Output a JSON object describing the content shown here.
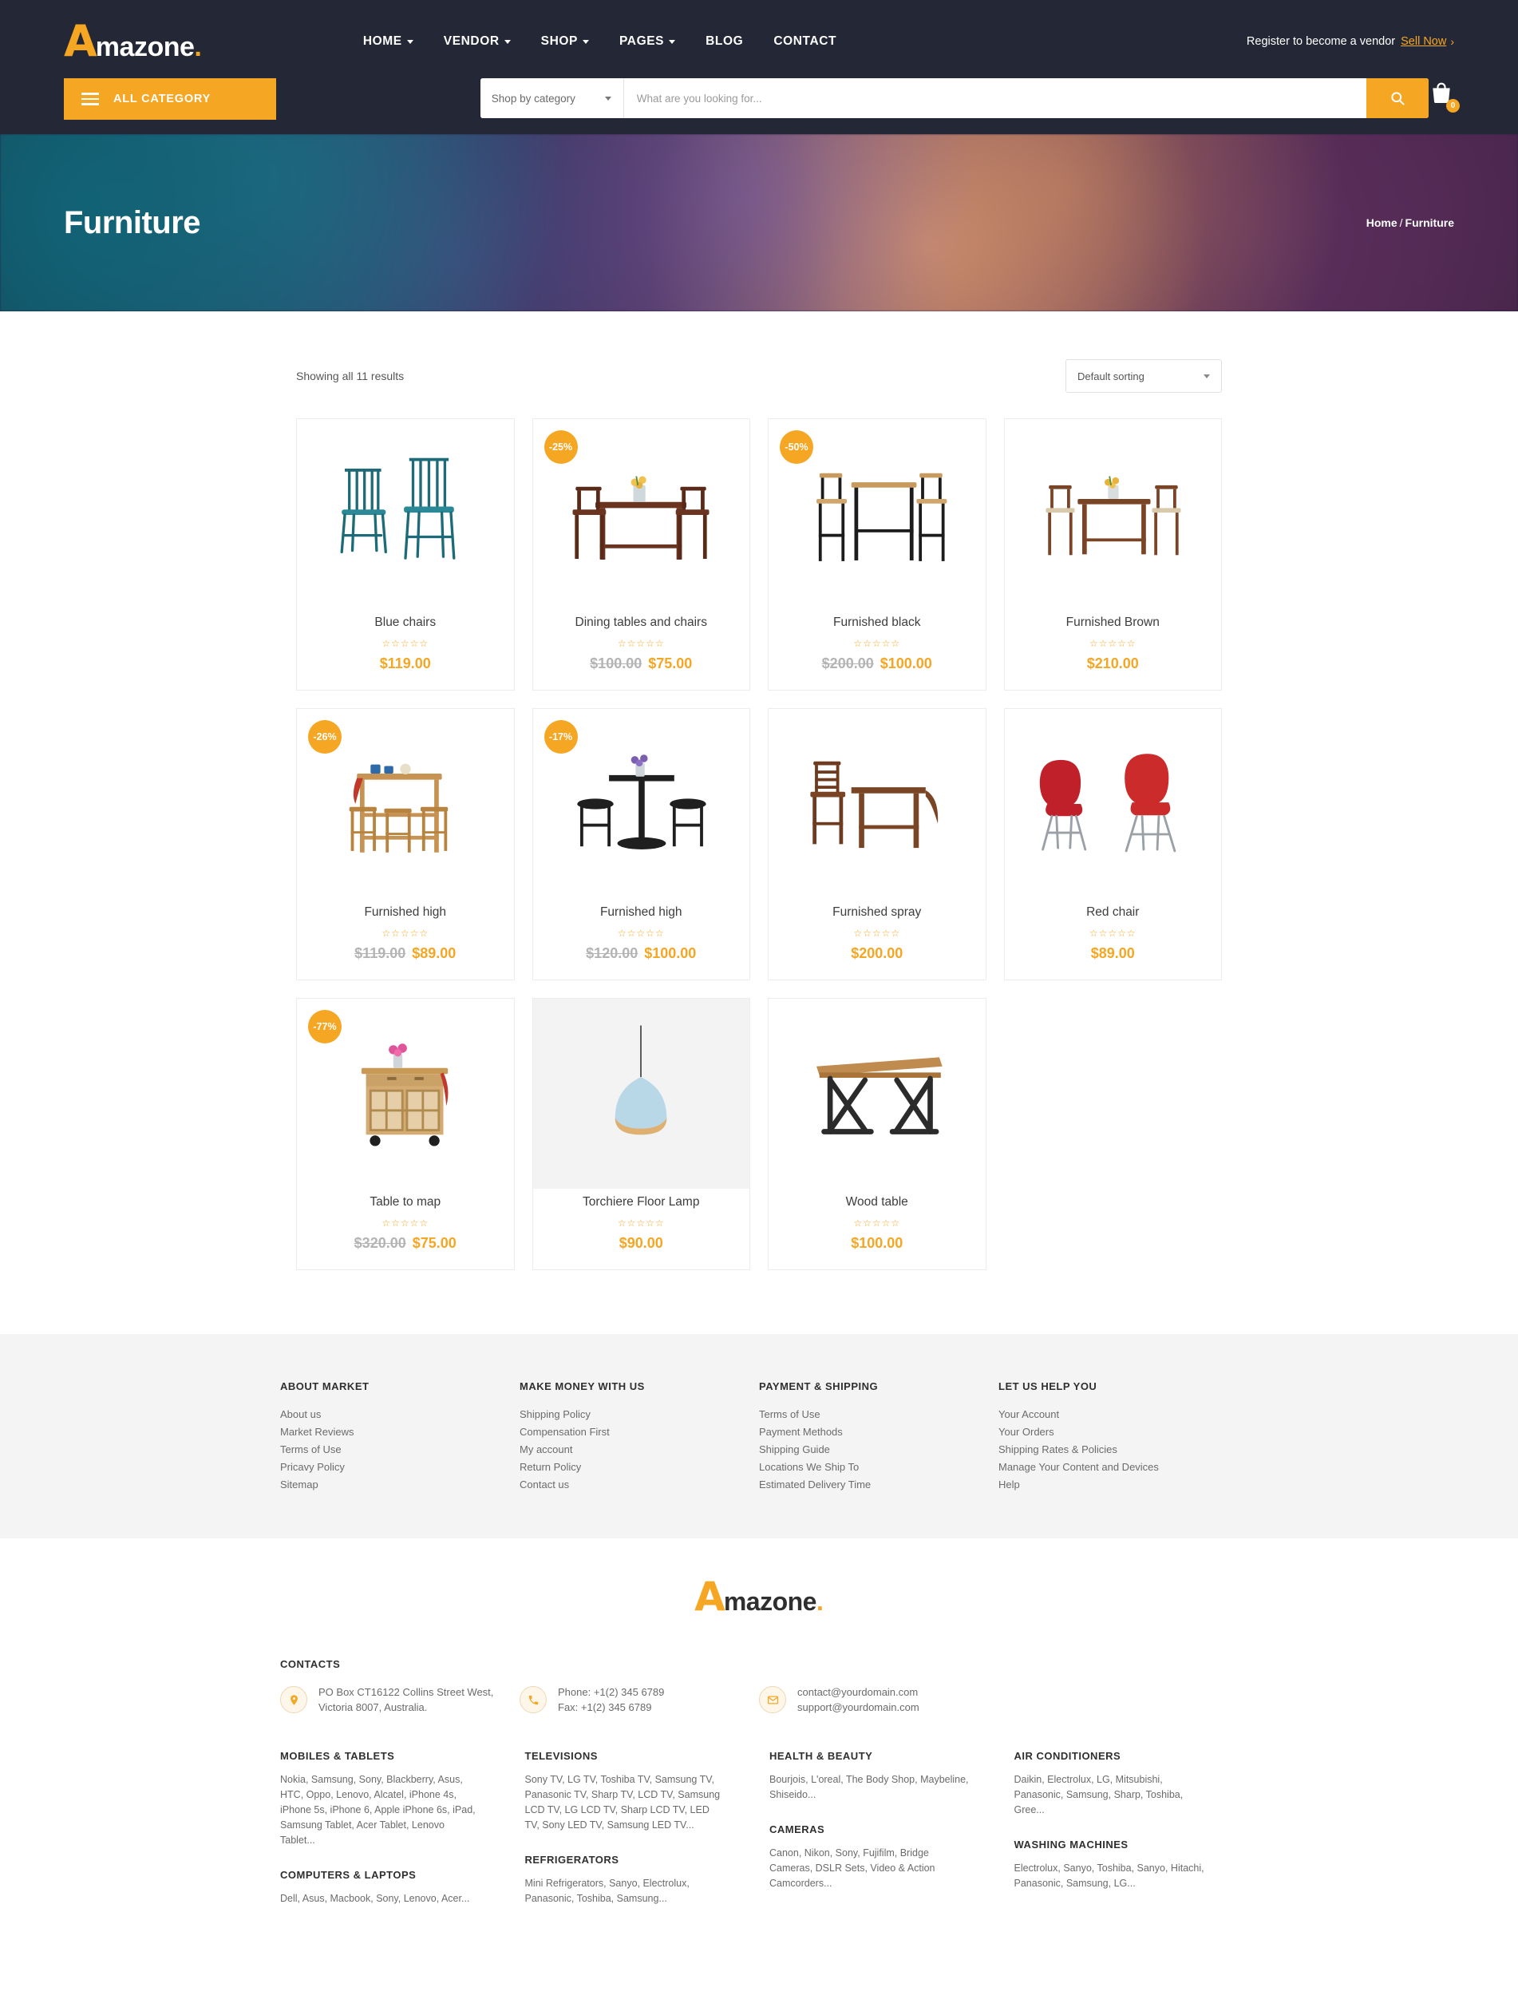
{
  "brand": {
    "logo_a": "A",
    "logo_text": "mazone",
    "logo_dot": ".",
    "accent": "#f5a623",
    "header_bg": "#242836"
  },
  "header": {
    "nav": [
      {
        "label": "HOME",
        "has_caret": true
      },
      {
        "label": "VENDOR",
        "has_caret": true
      },
      {
        "label": "SHOP",
        "has_caret": true
      },
      {
        "label": "PAGES",
        "has_caret": true
      },
      {
        "label": "BLOG",
        "has_caret": false
      },
      {
        "label": "CONTACT",
        "has_caret": false
      }
    ],
    "vendor_text": "Register to become a vendor",
    "sell_now": "Sell Now",
    "sell_arrow": "›"
  },
  "search": {
    "all_category": "ALL CATEGORY",
    "category_selected": "Shop by category",
    "placeholder": "What are you looking for...",
    "cart_count": "0"
  },
  "hero": {
    "title": "Furniture",
    "crumb_home": "Home",
    "crumb_sep": "/",
    "crumb_current": "Furniture"
  },
  "shop": {
    "result_count": "Showing all 11 results",
    "sort_selected": "Default sorting",
    "products": [
      {
        "title": "Blue chairs",
        "badge": null,
        "price_old": null,
        "price_new": "$119.00",
        "stars": "☆☆☆☆☆",
        "image": "blue-chairs"
      },
      {
        "title": "Dining tables and chairs",
        "badge": "-25%",
        "price_old": "$100.00",
        "price_new": "$75.00",
        "stars": "☆☆☆☆☆",
        "image": "dining-table-set"
      },
      {
        "title": "Furnished black",
        "badge": "-50%",
        "price_old": "$200.00",
        "price_new": "$100.00",
        "stars": "☆☆☆☆☆",
        "image": "bar-table-set"
      },
      {
        "title": "Furnished Brown",
        "badge": null,
        "price_old": null,
        "price_new": "$210.00",
        "stars": "☆☆☆☆☆",
        "image": "brown-dining-set"
      },
      {
        "title": "Furnished high",
        "badge": "-26%",
        "price_old": "$119.00",
        "price_new": "$89.00",
        "stars": "☆☆☆☆☆",
        "image": "kitchen-island-stools"
      },
      {
        "title": "Furnished high",
        "badge": "-17%",
        "price_old": "$120.00",
        "price_new": "$100.00",
        "stars": "☆☆☆☆☆",
        "image": "black-pub-table"
      },
      {
        "title": "Furnished spray",
        "badge": null,
        "price_old": null,
        "price_new": "$200.00",
        "stars": "☆☆☆☆☆",
        "image": "drop-leaf-table"
      },
      {
        "title": "Red chair",
        "badge": null,
        "price_old": null,
        "price_new": "$89.00",
        "stars": "☆☆☆☆☆",
        "image": "red-chairs"
      },
      {
        "title": "Table to map",
        "badge": "-77%",
        "price_old": "$320.00",
        "price_new": "$75.00",
        "stars": "☆☆☆☆☆",
        "image": "kitchen-cart"
      },
      {
        "title": "Torchiere Floor Lamp",
        "badge": null,
        "price_old": null,
        "price_new": "$90.00",
        "stars": "☆☆☆☆☆",
        "image": "pendant-lamp"
      },
      {
        "title": "Wood table",
        "badge": null,
        "price_old": null,
        "price_new": "$100.00",
        "stars": "☆☆☆☆☆",
        "image": "wood-table"
      }
    ]
  },
  "footer_links": [
    {
      "title": "ABOUT MARKET",
      "items": [
        "About us",
        "Market Reviews",
        "Terms of Use",
        "Pricavy Policy",
        "Sitemap"
      ]
    },
    {
      "title": "MAKE MONEY WITH US",
      "items": [
        "Shipping Policy",
        "Compensation First",
        "My account",
        "Return Policy",
        "Contact us"
      ]
    },
    {
      "title": "PAYMENT & SHIPPING",
      "items": [
        "Terms of Use",
        "Payment Methods",
        "Shipping Guide",
        "Locations We Ship To",
        "Estimated Delivery Time"
      ]
    },
    {
      "title": "LET US HELP YOU",
      "items": [
        "Your Account",
        "Your Orders",
        "Shipping Rates & Policies",
        "Manage Your Content and Devices",
        "Help"
      ]
    }
  ],
  "contacts": {
    "title": "CONTACTS",
    "address": "PO Box CT16122 Collins Street West, Victoria 8007, Australia.",
    "phone": "Phone: +1(2) 345 6789",
    "fax": "Fax: +1(2) 345 6789",
    "email1": "contact@yourdomain.com",
    "email2": "support@yourdomain.com"
  },
  "categories": [
    {
      "title": "MOBILES & TABLETS",
      "body": "Nokia, Samsung, Sony, Blackberry, Asus, HTC, Oppo, Lenovo, Alcatel, iPhone 4s, iPhone 5s, iPhone 6, Apple iPhone 6s, iPad, Samsung Tablet, Acer Tablet, Lenovo Tablet..."
    },
    {
      "title": "TELEVISIONS",
      "body": "Sony TV, LG TV, Toshiba TV, Samsung TV, Panasonic TV, Sharp TV, LCD TV, Samsung LCD TV, LG LCD TV, Sharp LCD TV, LED TV, Sony LED TV, Samsung LED TV..."
    },
    {
      "title": "HEALTH & BEAUTY",
      "body": "Bourjois, L'oreal, The Body Shop, Maybeline, Shiseido..."
    },
    {
      "title": "AIR CONDITIONERS",
      "body": "Daikin, Electrolux, LG, Mitsubishi, Panasonic, Samsung, Sharp, Toshiba, Gree..."
    },
    {
      "title": "COMPUTERS & LAPTOPS",
      "body": "Dell, Asus, Macbook, Sony, Lenovo, Acer..."
    },
    {
      "title": "REFRIGERATORS",
      "body": "Mini Refrigerators, Sanyo, Electrolux, Panasonic, Toshiba, Samsung..."
    },
    {
      "title": "CAMERAS",
      "body": "Canon, Nikon, Sony, Fujifilm, Bridge Cameras, DSLR Sets, Video & Action Camcorders..."
    },
    {
      "title": "WASHING MACHINES",
      "body": "Electrolux, Sanyo, Toshiba, Sanyo, Hitachi, Panasonic, Samsung, LG..."
    }
  ]
}
